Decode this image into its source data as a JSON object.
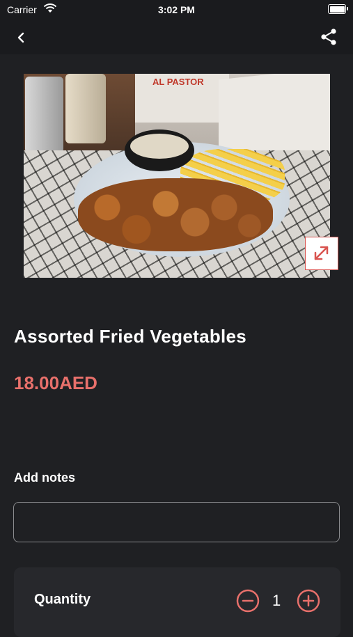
{
  "status_bar": {
    "carrier": "Carrier",
    "time": "3:02 PM"
  },
  "nav": {
    "back_icon": "chevron-left-icon",
    "share_icon": "share-icon"
  },
  "product": {
    "image_brand_text": "AL PASTOR",
    "name": "Assorted Fried Vegetables",
    "price": "18.00AED",
    "expand_icon": "expand-icon"
  },
  "notes": {
    "label": "Add notes",
    "value": "",
    "placeholder": ""
  },
  "quantity": {
    "label": "Quantity",
    "value": "1",
    "minus_icon": "minus-circle-icon",
    "plus_icon": "plus-circle-icon"
  },
  "colors": {
    "background": "#1f2023",
    "accent": "#e8706b",
    "card": "#27282c"
  }
}
